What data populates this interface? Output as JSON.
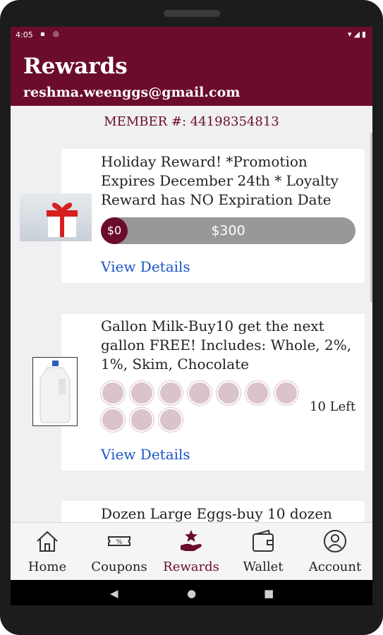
{
  "status_bar": {
    "time": "4:05"
  },
  "app_bar": {
    "title": "Rewards",
    "email": "reshma.weenggs@gmail.com"
  },
  "member": {
    "label": "MEMBER #: 44198354813"
  },
  "rewards": [
    {
      "title": "Holiday Reward! *Promotion Expires December 24th * Loyalty Reward has NO Expiration Date",
      "progress_start": "$0",
      "progress_goal": "$300",
      "progress_fraction": 0,
      "view_details": "View Details"
    },
    {
      "title": "Gallon Milk-Buy10 get the next gallon FREE! Includes: Whole, 2%, 1%, Skim, Chocolate",
      "stamps_total": 10,
      "stamps_filled": 0,
      "left_label": "10 Left",
      "view_details": "View Details"
    },
    {
      "title": "Dozen Large Eggs-buy 10 dozen"
    }
  ],
  "bottom_nav": {
    "home": "Home",
    "coupons": "Coupons",
    "rewards": "Rewards",
    "wallet": "Wallet",
    "account": "Account"
  },
  "colors": {
    "brand": "#6b0d2a",
    "link": "#1a56c8",
    "stamp": "#dbc3cb"
  }
}
